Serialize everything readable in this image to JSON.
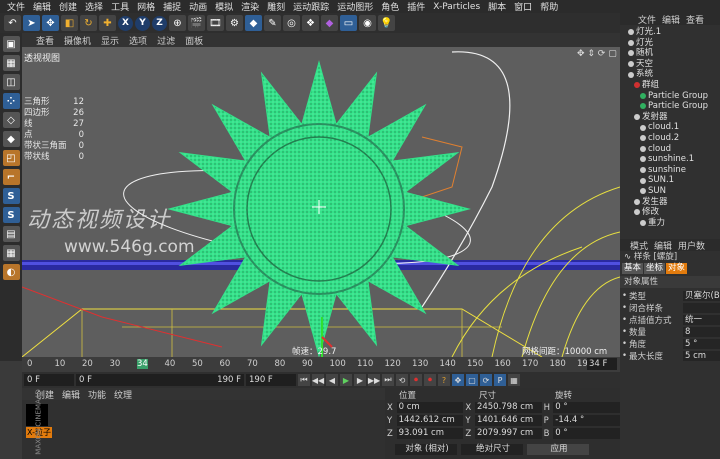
{
  "menu": [
    "文件",
    "编辑",
    "创建",
    "选择",
    "工具",
    "网格",
    "捕捉",
    "动画",
    "模拟",
    "渲染",
    "雕刻",
    "运动跟踪",
    "运动图形",
    "角色",
    "插件",
    "X-Particles",
    "脚本",
    "窗口",
    "帮助"
  ],
  "viewport_menu": [
    "查看",
    "摄像机",
    "显示",
    "选项",
    "过滤",
    "面板"
  ],
  "viewport_label": "透视视图",
  "stats": [
    {
      "label": "三角形",
      "value": "12"
    },
    {
      "label": "四边形",
      "value": "26"
    },
    {
      "label": "线",
      "value": "27"
    },
    {
      "label": "点",
      "value": "0"
    },
    {
      "label": "带状三角面",
      "value": "0"
    },
    {
      "label": "带状线",
      "value": "0"
    }
  ],
  "watermark": {
    "line1": "动态视频设计",
    "line2": "www.546g.com"
  },
  "fps": "帧速：29.7",
  "grid_spacing": "网格间距：10000 cm",
  "object_manager": {
    "menu": [
      "文件",
      "编辑",
      "查看"
    ],
    "items": [
      {
        "name": "灯光.1",
        "color": "#cccccc"
      },
      {
        "name": "灯光",
        "color": "#cccccc"
      },
      {
        "name": "随机",
        "color": "#cccccc"
      },
      {
        "name": "天空",
        "color": "#cccccc"
      },
      {
        "name": "系统",
        "color": "#cccccc"
      },
      {
        "name": "群组",
        "color": "#d03030"
      },
      {
        "name": "Particle Group",
        "color": "#30b060"
      },
      {
        "name": "Particle Group",
        "color": "#30b060"
      },
      {
        "name": "发射器",
        "color": "#cccccc"
      },
      {
        "name": "cloud.1",
        "color": "#cccccc"
      },
      {
        "name": "cloud.2",
        "color": "#cccccc"
      },
      {
        "name": "cloud",
        "color": "#cccccc"
      },
      {
        "name": "sunshine.1",
        "color": "#cccccc"
      },
      {
        "name": "sunshine",
        "color": "#cccccc"
      },
      {
        "name": "SUN.1",
        "color": "#cccccc"
      },
      {
        "name": "SUN",
        "color": "#cccccc"
      },
      {
        "name": "发生器",
        "color": "#cccccc"
      },
      {
        "name": "修改",
        "color": "#cccccc"
      },
      {
        "name": "重力",
        "color": "#cccccc"
      }
    ]
  },
  "attributes": {
    "menu": [
      "模式",
      "编辑",
      "用户数"
    ],
    "title": "样条 [螺旋]",
    "tabs": [
      "基本",
      "坐标",
      "对象"
    ],
    "active_tab": "对象",
    "section": "对象属性",
    "props": [
      {
        "label": "类型",
        "value": "贝塞尔(B"
      },
      {
        "label": "闭合样条",
        "value": ""
      },
      {
        "label": "点插值方式",
        "value": "统一"
      },
      {
        "label": "数量",
        "value": "8"
      },
      {
        "label": "角度",
        "value": "5 °"
      },
      {
        "label": "最大长度",
        "value": "5 cm"
      }
    ]
  },
  "timeline": {
    "ticks": [
      "0",
      "10",
      "20",
      "30",
      "34",
      "40",
      "50",
      "60",
      "70",
      "80",
      "90",
      "100",
      "110",
      "120",
      "130",
      "140",
      "150",
      "160",
      "170",
      "180",
      "19"
    ],
    "current": "34 F",
    "start": "0 F",
    "range_start": "0 F",
    "range_end": "190 F",
    "end": "190 F"
  },
  "material": {
    "menu": [
      "创建",
      "编辑",
      "功能",
      "纹理"
    ],
    "swatch_label": "X-粒子"
  },
  "coordinates": {
    "headers": [
      "位置",
      "尺寸",
      "旋转"
    ],
    "rows": [
      {
        "axis": "X",
        "pos": "0 cm",
        "size": "2450.798 cm",
        "rot_label": "H",
        "rot": "0 °"
      },
      {
        "axis": "Y",
        "pos": "1442.612 cm",
        "size": "1401.646 cm",
        "rot_label": "P",
        "rot": "-14.4 °"
      },
      {
        "axis": "Z",
        "pos": "93.091 cm",
        "size": "2079.997 cm",
        "rot_label": "B",
        "rot": "0 °"
      }
    ],
    "mode": "对象 (相对)",
    "size_mode": "绝对尺寸",
    "apply": "应用"
  },
  "brand": "MAXON CINEMA4D",
  "colors": {
    "sun": "#34e28a",
    "accent": "#e27b0d",
    "blue_tool": "#2f5f96"
  }
}
